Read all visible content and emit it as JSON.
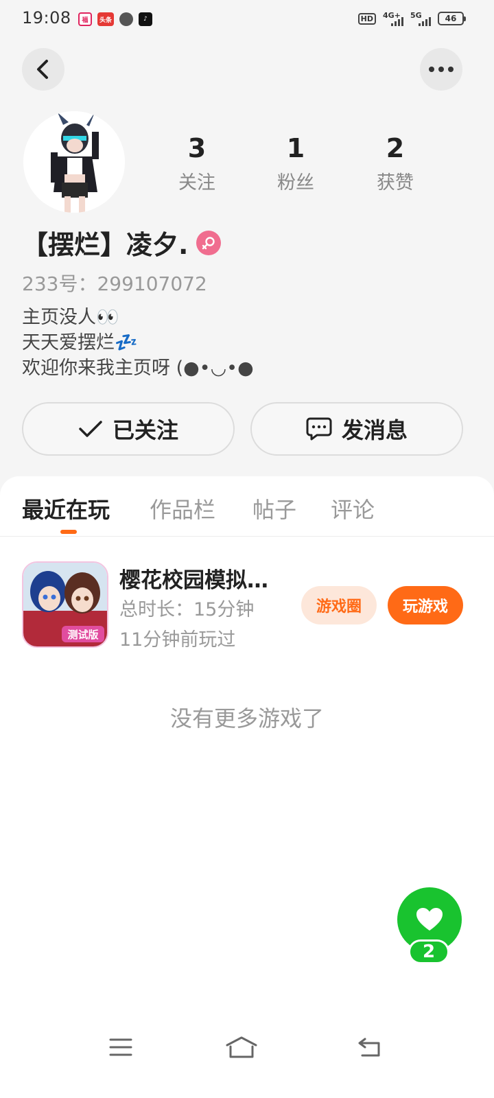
{
  "status_bar": {
    "time": "19:08",
    "network_1": "4G+",
    "network_2": "5G",
    "hd": "HD",
    "battery": "46"
  },
  "profile": {
    "stats": [
      {
        "value": "3",
        "label": "关注"
      },
      {
        "value": "1",
        "label": "粉丝"
      },
      {
        "value": "2",
        "label": "获赞"
      }
    ],
    "nickname": "【摆烂】凌夕.",
    "gender_icon": "female-icon",
    "id_text": "233号：299107072",
    "bio": [
      "主页没人👀",
      "天天爱摆烂💤",
      "欢迎你来我主页呀 (●•◡•●"
    ]
  },
  "actions": {
    "follow_label": "已关注",
    "message_label": "发消息"
  },
  "tabs": [
    "最近在玩",
    "作品栏",
    "帖子",
    "评论"
  ],
  "active_tab": "最近在玩",
  "games": [
    {
      "title": "樱花校园模拟…",
      "duration": "总时长：15分钟",
      "last_played": "11分钟前玩过",
      "icon_badge": "测试版",
      "circle_button": "游戏圈",
      "play_button": "玩游戏"
    }
  ],
  "no_more_text": "没有更多游戏了",
  "like": {
    "count": "2"
  },
  "colors": {
    "accent": "#ff6a16",
    "like_green": "#19c32f",
    "female_pink": "#f06d8f"
  }
}
